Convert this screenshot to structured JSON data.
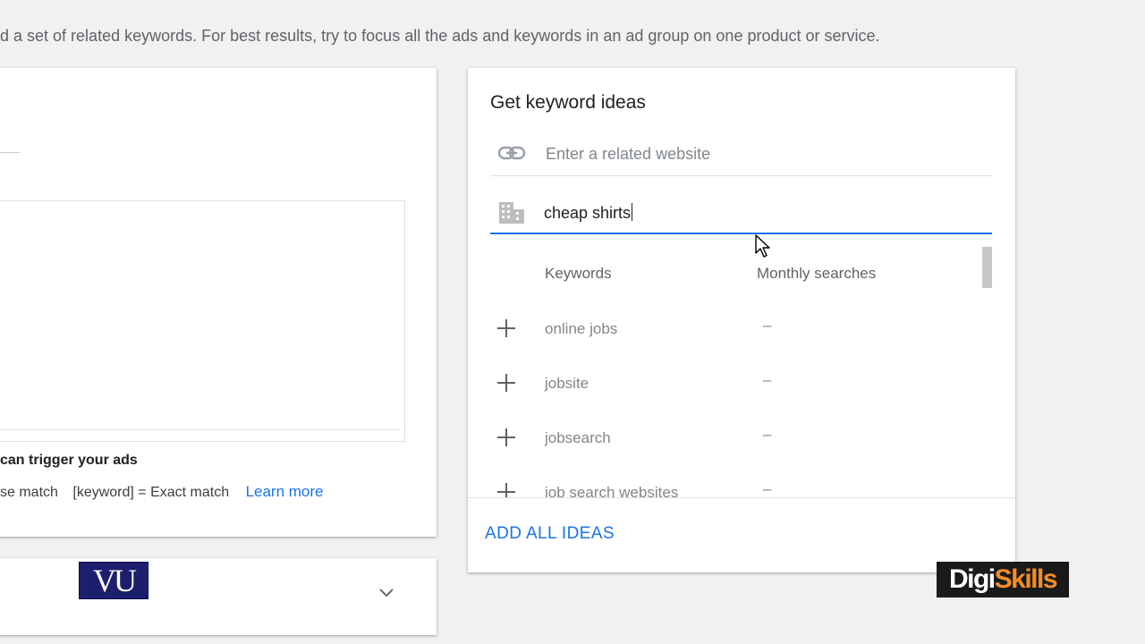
{
  "intro_text": "d a set of related keywords. For best results, try to focus all the ads and keywords in an ad group on one product or service.",
  "left_panel": {
    "trigger_heading": "can trigger your ads",
    "match_phrase": "se match",
    "match_exact": "[keyword] = Exact match",
    "learn_more": "Learn more"
  },
  "bottom_panel": {
    "logo_text": "VU"
  },
  "keyword_ideas": {
    "title": "Get keyword ideas",
    "website_placeholder": "Enter a related website",
    "query_value": "cheap shirts",
    "col_keywords": "Keywords",
    "col_monthly": "Monthly searches",
    "rows": [
      {
        "keyword": "online jobs",
        "monthly": "–"
      },
      {
        "keyword": "jobsite",
        "monthly": "–"
      },
      {
        "keyword": "jobsearch",
        "monthly": "–"
      },
      {
        "keyword": "job search websites",
        "monthly": "–"
      }
    ],
    "add_all": "ADD ALL IDEAS"
  },
  "watermark": {
    "part1": "Digi",
    "part2": "Skills"
  },
  "colors": {
    "accent": "#1a73e8",
    "watermark_orange": "#f28c28"
  }
}
